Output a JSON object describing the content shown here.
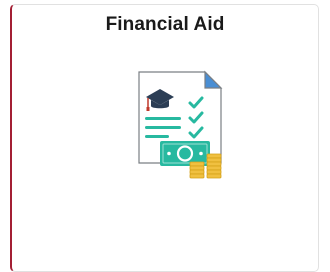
{
  "tile": {
    "title": "Financial Aid",
    "icon": "financial-aid-icon",
    "accent_color": "#a31f34"
  }
}
